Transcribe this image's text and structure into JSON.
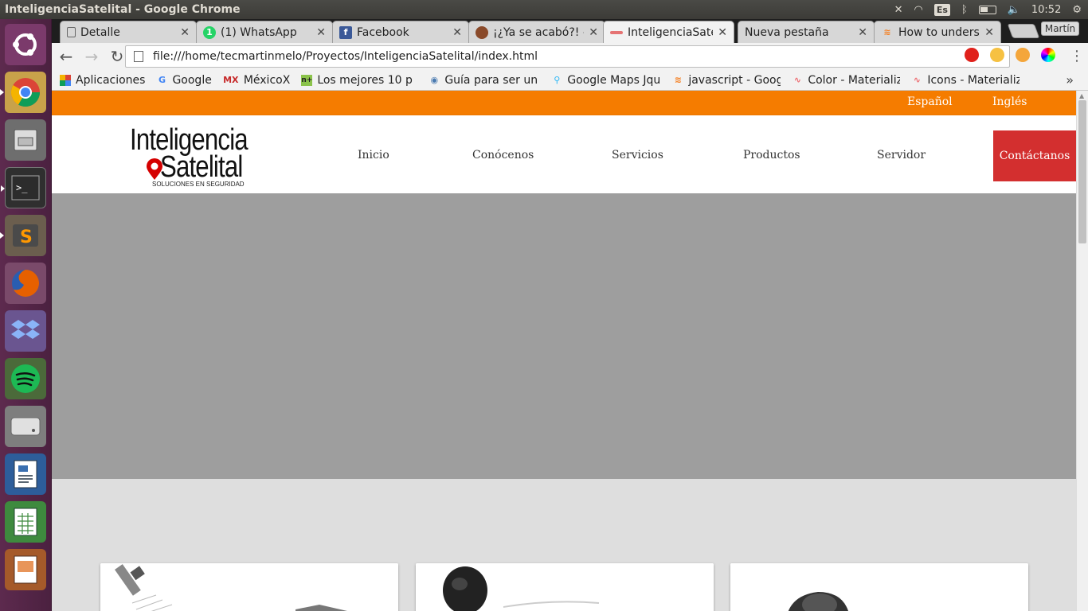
{
  "os": {
    "window_title": "InteligenciaSatelital - Google Chrome",
    "keyboard_layout": "Es",
    "clock": "10:52",
    "launcher_apps": [
      "ubuntu-dash",
      "chrome",
      "files",
      "terminal",
      "sublime-text",
      "firefox",
      "dropbox",
      "spotify",
      "disk",
      "libreoffice-writer",
      "libreoffice-calc",
      "libreoffice-impress"
    ]
  },
  "browser": {
    "tabs": [
      {
        "label": "Detalle",
        "icon": "page-icon"
      },
      {
        "label": "(1) WhatsApp",
        "icon": "whatsapp-icon",
        "badge": "1"
      },
      {
        "label": "Facebook",
        "icon": "facebook-icon"
      },
      {
        "label": "¡¿Ya se acabó?! –",
        "icon": "site-icon"
      },
      {
        "label": "InteligenciaSate",
        "icon": "site-icon",
        "active": true
      },
      {
        "label": "Nueva pestaña",
        "icon": ""
      },
      {
        "label": "How to underst",
        "icon": "stackoverflow-icon"
      }
    ],
    "profile_name": "Martín",
    "url": "file:///home/tecmartinmelo/Proyectos/InteligenciaSatelital/index.html",
    "bookmarks": [
      {
        "label": "Aplicaciones",
        "icon": "apps-grid-icon"
      },
      {
        "label": "Google",
        "icon": "google-icon"
      },
      {
        "label": "MéxicoX",
        "icon": "mx-icon"
      },
      {
        "label": "Los mejores 10 p",
        "icon": "n-icon"
      },
      {
        "label": "Guía para ser un",
        "icon": "alien-icon"
      },
      {
        "label": "Google Maps Jqu",
        "icon": "maps-pin-icon"
      },
      {
        "label": "javascript - Goog",
        "icon": "stackoverflow-icon"
      },
      {
        "label": "Color - Materializ",
        "icon": "materialize-icon"
      },
      {
        "label": "Icons - Materializ",
        "icon": "materialize-icon"
      }
    ],
    "bookmarks_more": "»"
  },
  "site": {
    "lang_es": "Español",
    "lang_en": "Inglés",
    "logo_line1": "Inteligencia",
    "logo_line2": "Satelital",
    "logo_tagline": "SOLUCIONES EN SEGURIDAD",
    "nav": {
      "inicio": "Inicio",
      "conocenos": "Conócenos",
      "servicios": "Servicios",
      "productos": "Productos",
      "servidor": "Servidor",
      "contacto": "Contáctanos"
    },
    "colors": {
      "lang_bar": "#f57c00",
      "cta": "#d32f2f",
      "hero": "#9e9e9e",
      "section_bg": "#dedede"
    }
  }
}
